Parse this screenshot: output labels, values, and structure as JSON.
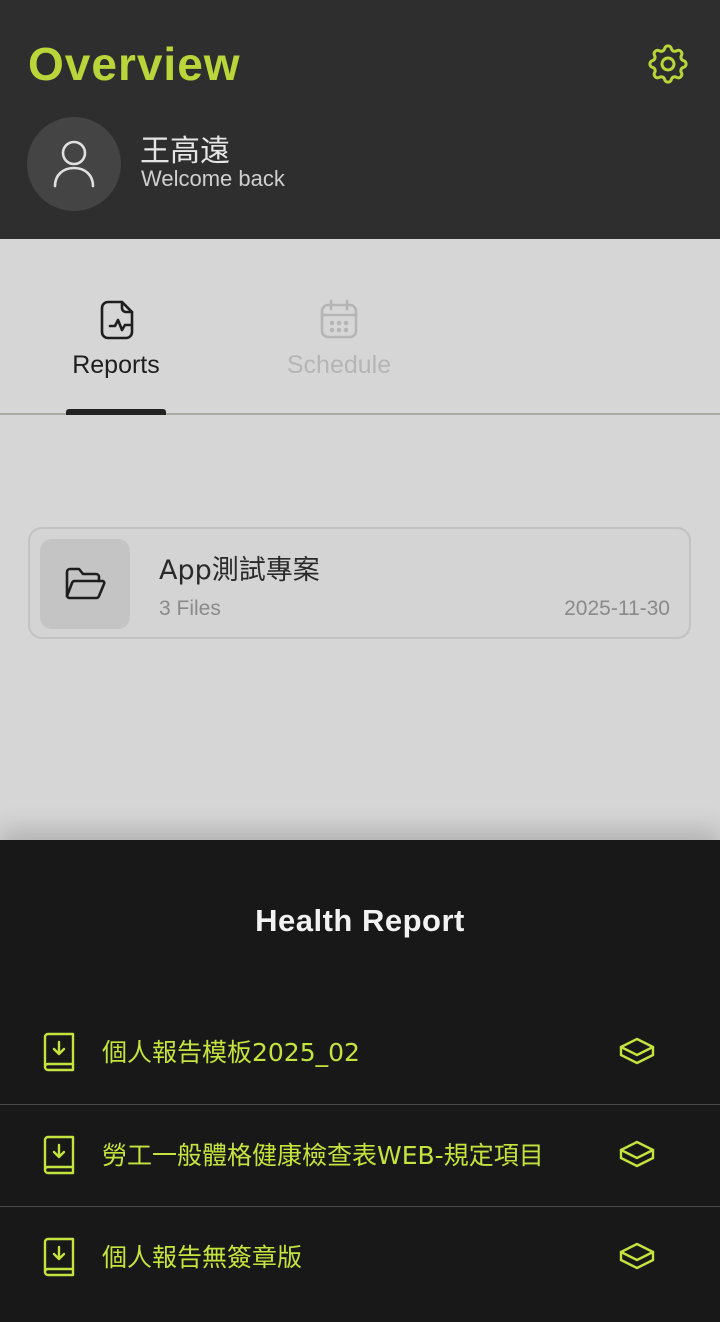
{
  "header": {
    "title": "Overview",
    "user_name": "王高遠",
    "welcome_text": "Welcome back",
    "settings_icon": "gear-icon",
    "avatar_icon": "person-icon"
  },
  "tabs": [
    {
      "label": "Reports",
      "icon": "document-pulse-icon",
      "active": true
    },
    {
      "label": "Schedule",
      "icon": "calendar-icon",
      "active": false
    }
  ],
  "project": {
    "name": "App測試專案",
    "files": "3 Files",
    "date": "2025-11-30",
    "icon": "folder-icon"
  },
  "sheet": {
    "title": "Health Report",
    "items": [
      {
        "label": "個人報告模板2025_02",
        "icon": "download-document-icon",
        "action_icon": "layers-icon"
      },
      {
        "label": "勞工一般體格健康檢查表WEB-規定項目",
        "icon": "download-document-icon",
        "action_icon": "layers-icon"
      },
      {
        "label": "個人報告無簽章版",
        "icon": "download-document-icon",
        "action_icon": "layers-icon"
      }
    ]
  },
  "colors": {
    "accent": "#b8d63a",
    "header_bg": "#2e2e2e",
    "content_bg": "#d6d6d6",
    "sheet_bg": "#181818",
    "sheet_item": "#c3e33e"
  }
}
